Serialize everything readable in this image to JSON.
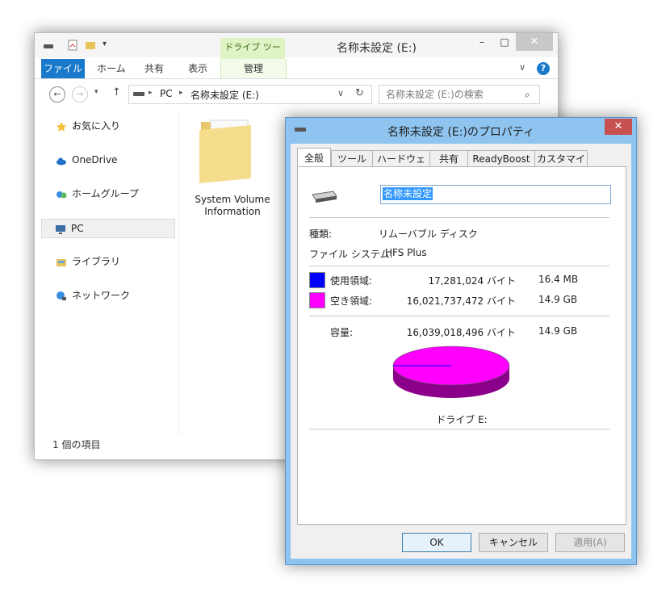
{
  "explorer": {
    "title": "名称未設定 (E:)",
    "context_tab": "ドライブ ツール",
    "ribbon_tabs": [
      "ファイル",
      "ホーム",
      "共有",
      "表示",
      "管理"
    ],
    "window_buttons": {
      "minimize": "–",
      "maximize": "□",
      "close": "✕"
    },
    "address": {
      "pc": "PC",
      "drive": "名称未設定 (E:)"
    },
    "search_placeholder": "名称未設定 (E:)の検索",
    "nav_items": [
      "お気に入り",
      "OneDrive",
      "ホームグループ",
      "PC",
      "ライブラリ",
      "ネットワーク"
    ],
    "folder_label": "System Volume Information",
    "status": "1 個の項目"
  },
  "dialog": {
    "title": "名称未設定 (E:)のプロパティ",
    "tabs": [
      "全般",
      "ツール",
      "ハードウェア",
      "共有",
      "ReadyBoost",
      "カスタマイズ"
    ],
    "volume_name": "名称未設定",
    "type_label": "種類:",
    "type_value": "リムーバブル ディスク",
    "fs_label": "ファイル システム:",
    "fs_value": "HFS Plus",
    "used_label": "使用領域:",
    "used_bytes": "17,281,024 バイト",
    "used_size": "16.4 MB",
    "free_label": "空き領域:",
    "free_bytes": "16,021,737,472 バイト",
    "free_size": "14.9 GB",
    "capacity_label": "容量:",
    "capacity_bytes": "16,039,018,496 バイト",
    "capacity_size": "14.9 GB",
    "drive_label": "ドライブ E:",
    "buttons": {
      "ok": "OK",
      "cancel": "キャンセル",
      "apply": "適用(A)"
    },
    "used_color": "#0000ff",
    "free_color": "#ff00ff",
    "used_fraction": 0.0011
  }
}
